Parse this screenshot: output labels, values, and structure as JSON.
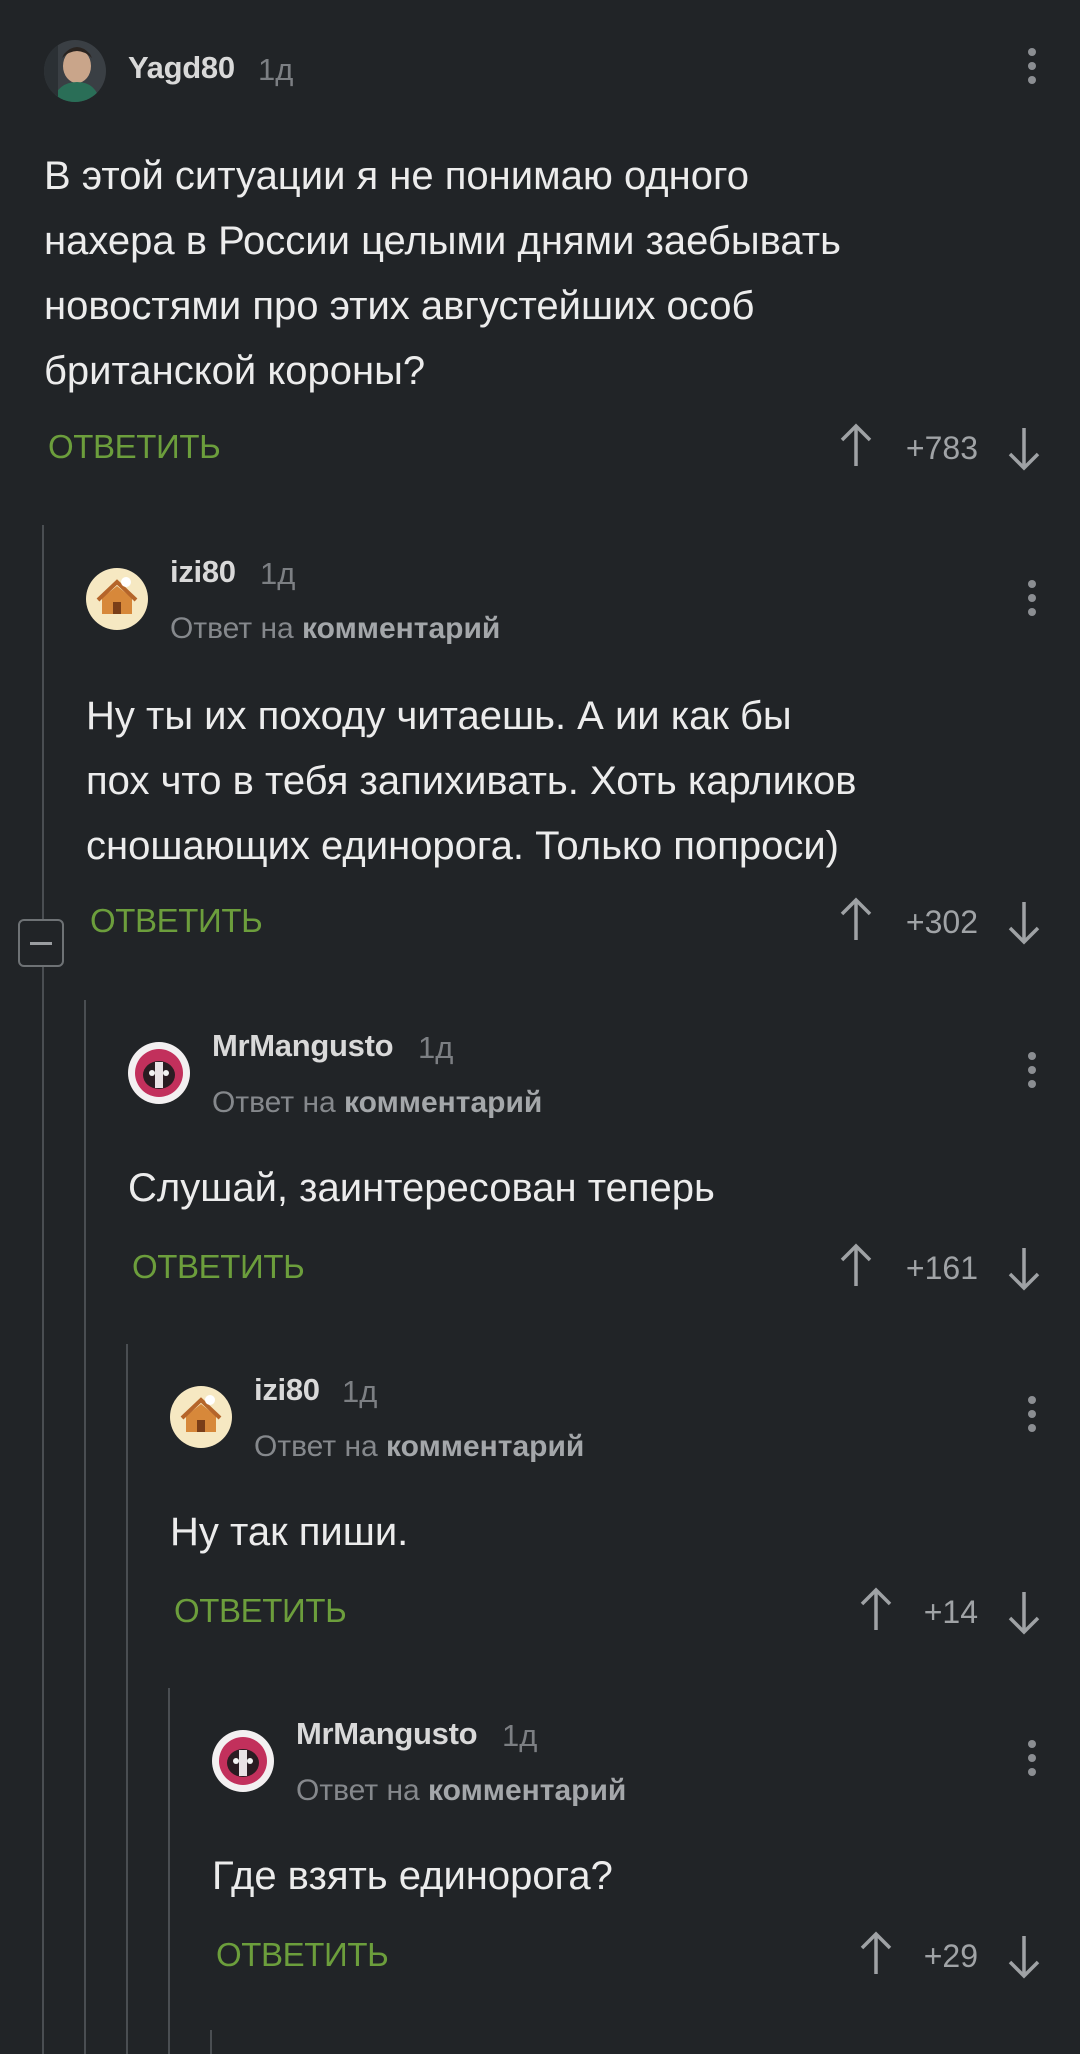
{
  "comments": [
    {
      "username": "Yagd80",
      "time": "1д",
      "reply_prefix": "",
      "reply_target": "",
      "text": "В этой ситуации я не понимаю одного\nнахера в России целыми днями заебывать\nновостями про этих августейших особ\nбританской короны?",
      "reply_label": "ОТВЕТИТЬ",
      "score": "+783",
      "avatar": "portrait-avatar"
    },
    {
      "username": "izi80",
      "time": "1д",
      "reply_prefix": "Ответ на ",
      "reply_target": "комментарий",
      "text": "Ну ты их походу читаешь. А ии как бы\nпох что в тебя запихивать. Хоть карликов\nсношающих единорога. Только попроси)",
      "reply_label": "ОТВЕТИТЬ",
      "score": "+302",
      "avatar": "house-avatar"
    },
    {
      "username": "MrMangusto",
      "time": "1д",
      "reply_prefix": "Ответ на ",
      "reply_target": "комментарий",
      "text": "Слушай, заинтересован теперь",
      "reply_label": "ОТВЕТИТЬ",
      "score": "+161",
      "avatar": "badger-avatar"
    },
    {
      "username": "izi80",
      "time": "1д",
      "reply_prefix": "Ответ на ",
      "reply_target": "комментарий",
      "text": "Ну так пиши.",
      "reply_label": "ОТВЕТИТЬ",
      "score": "+14",
      "avatar": "house-avatar"
    },
    {
      "username": "MrMangusto",
      "time": "1д",
      "reply_prefix": "Ответ на ",
      "reply_target": "комментарий",
      "text": "Где взять единорога?",
      "reply_label": "ОТВЕТИТЬ",
      "score": "+29",
      "avatar": "badger-avatar"
    }
  ],
  "icons": {
    "upvote": "arrow-up-icon",
    "downvote": "arrow-down-icon",
    "menu": "more-vertical-icon",
    "collapse": "collapse-minus-icon"
  },
  "colors": {
    "background": "#212427",
    "reply_green": "#6c9e3c",
    "thread_line": "#4a4e52"
  }
}
